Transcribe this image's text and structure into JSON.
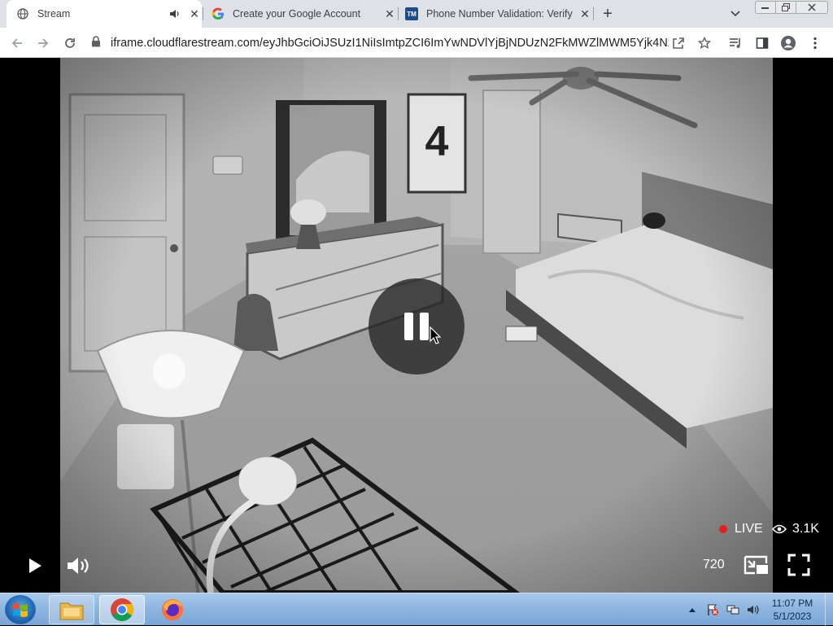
{
  "browser": {
    "tabs": [
      {
        "title": "Stream",
        "active": true,
        "audio": true,
        "favicon": "globe-icon"
      },
      {
        "title": "Create your Google Account",
        "active": false,
        "favicon": "google-icon"
      },
      {
        "title": "Phone Number Validation: Verify",
        "active": false,
        "favicon": "tm-icon"
      }
    ],
    "tm_favicon_text": "TM",
    "url": "iframe.cloudflarestream.com/eyJhbGciOiJSUzI1NiIsImtpZCI6ImYwNDVlYjBjNDUzN2FkMWZlMWM5Yjk4NzN..."
  },
  "player": {
    "state": "playing",
    "live_label": "LIVE",
    "viewer_count": "3.1K",
    "quality": "720",
    "poster_number": "4"
  },
  "taskbar": {
    "apps": [
      "windows-explorer",
      "google-chrome",
      "firefox"
    ],
    "clock": {
      "time": "11:07 PM",
      "date": "5/1/2023"
    }
  },
  "colors": {
    "live_dot": "#e02020",
    "tabstrip": "#dee1e6",
    "taskbar": "#8fb6e0"
  }
}
